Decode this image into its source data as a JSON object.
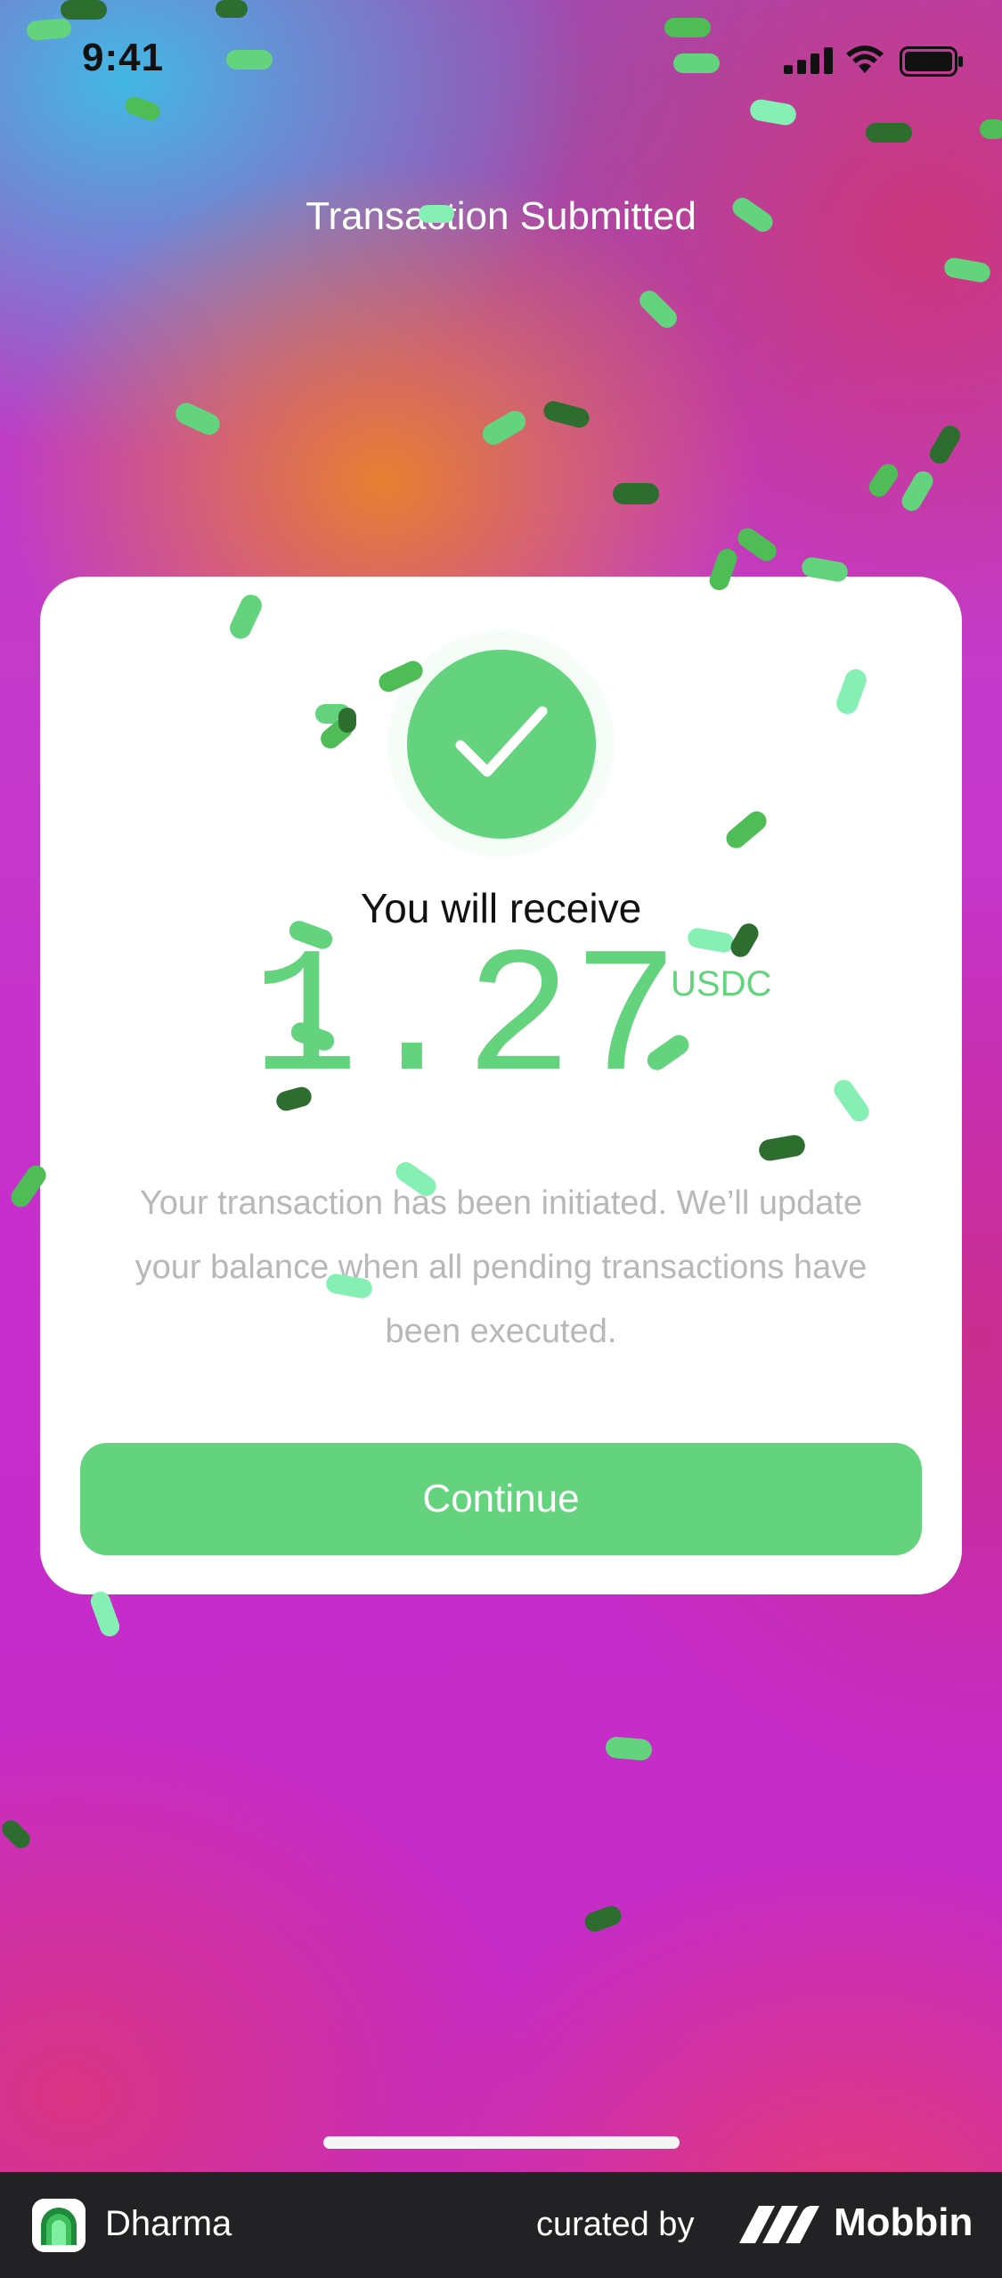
{
  "status_bar": {
    "time": "9:41"
  },
  "header": {
    "title": "Transaction Submitted"
  },
  "receipt": {
    "label": "You will receive",
    "amount": "1.27",
    "currency": "USDC",
    "message": "Your transaction has been initiated. We’ll update your balance when all pending transactions have been executed."
  },
  "actions": {
    "continue_label": "Continue"
  },
  "footer": {
    "app_name": "Dharma",
    "curated_label": "curated by",
    "brand": "Mobbin"
  },
  "colors": {
    "accent_green": "#63d37d",
    "confetti_dark": "#2d6e2f",
    "confetti_mid": "#4fbd56",
    "confetti_light": "#86f0b4",
    "message_gray": "#b8b8b8",
    "footer_bg": "#222224"
  },
  "icons": [
    "signal-icon",
    "wifi-icon",
    "battery-icon",
    "checkmark-icon",
    "dharma-logo-icon",
    "mobbin-logo-icon"
  ]
}
